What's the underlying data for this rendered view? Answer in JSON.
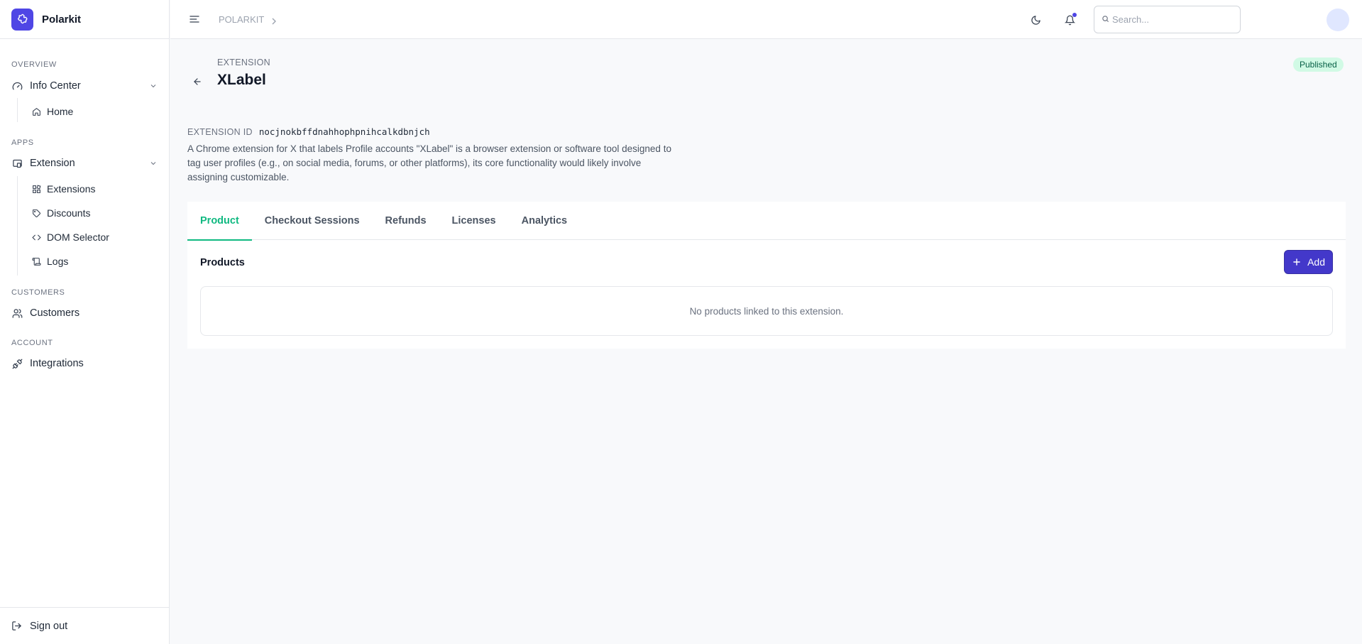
{
  "brand": {
    "name": "Polarkit",
    "logo_icon": "puzzle-icon",
    "accent": "#4f46e5"
  },
  "sidebar": {
    "sections": [
      {
        "label": "OVERVIEW"
      },
      {
        "label": "APPS"
      },
      {
        "label": "CUSTOMERS"
      },
      {
        "label": "ACCOUNT"
      }
    ],
    "info_center": {
      "label": "Info Center",
      "icon": "gauge-icon"
    },
    "home": {
      "label": "Home",
      "icon": "home-icon"
    },
    "extension": {
      "label": "Extension",
      "icon": "extension-window-icon"
    },
    "extensions": {
      "label": "Extensions",
      "icon": "blocks-icon"
    },
    "discounts": {
      "label": "Discounts",
      "icon": "tag-icon"
    },
    "dom_selector": {
      "label": "DOM Selector",
      "icon": "code-icon"
    },
    "logs": {
      "label": "Logs",
      "icon": "scroll-icon"
    },
    "customers": {
      "label": "Customers",
      "icon": "users-icon"
    },
    "integrations": {
      "label": "Integrations",
      "icon": "plug-icon"
    },
    "sign_out": {
      "label": "Sign out",
      "icon": "logout-icon"
    }
  },
  "topbar": {
    "breadcrumb": "POLARKIT",
    "search_placeholder": "Search..."
  },
  "page": {
    "eyebrow": "EXTENSION",
    "title": "XLabel",
    "status": "Published",
    "status_color": "#d1fae5",
    "extension_id_label": "EXTENSION ID",
    "extension_id": "nocjnokbffdnahhophpnihcalkdbnjch",
    "description": "A Chrome extension for X that labels Profile accounts \"XLabel\" is a browser extension or software tool designed to tag user profiles (e.g., on social media, forums, or other platforms), its core functionality would likely involve assigning customizable."
  },
  "tabs": [
    "Product",
    "Checkout Sessions",
    "Refunds",
    "Licenses",
    "Analytics"
  ],
  "active_tab": "Product",
  "active_color": "#10b981",
  "products": {
    "title": "Products",
    "add_label": "Add",
    "empty_text": "No products linked to this extension."
  }
}
